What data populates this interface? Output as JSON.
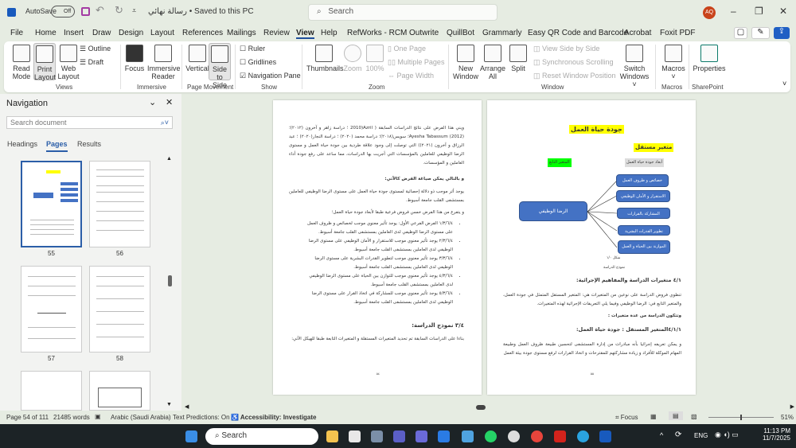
{
  "titlebar": {
    "autosave_label": "AutoSave",
    "autosave_state": "Off",
    "doc_title": "رسالة نهائي • Saved to this PC",
    "search_placeholder": "Search",
    "avatar_initials": "AQ"
  },
  "menu": [
    "File",
    "Home",
    "Insert",
    "Draw",
    "Design",
    "Layout",
    "References",
    "Mailings",
    "Review",
    "View",
    "Help",
    "RefWorks - RCM",
    "Outwrite",
    "QuillBot",
    "Grammarly",
    "Easy QR Code and Barcode",
    "Acrobat",
    "Foxit PDF"
  ],
  "ribbon": {
    "views": {
      "read": "Read Mode",
      "print": "Print Layout",
      "web": "Web Layout",
      "outline": "Outline",
      "draft": "Draft",
      "label": "Views"
    },
    "immersive": {
      "focus": "Focus",
      "reader": "Immersive Reader",
      "label": "Immersive"
    },
    "movement": {
      "vertical": "Vertical",
      "side": "Side to Side",
      "label": "Page Movement"
    },
    "show": {
      "ruler": "Ruler",
      "gridlines": "Gridlines",
      "navpane": "Navigation Pane",
      "label": "Show"
    },
    "zoom": {
      "thumbnails": "Thumbnails",
      "zoom": "Zoom",
      "pct": "100%",
      "one": "One Page",
      "multi": "Multiple Pages",
      "width": "Page Width",
      "label": "Zoom"
    },
    "window": {
      "new": "New Window",
      "arrange": "Arrange All",
      "split": "Split",
      "sbs": "View Side by Side",
      "sync": "Synchronous Scrolling",
      "reset": "Reset Window Position",
      "switch": "Switch Windows",
      "label": "Window"
    },
    "macros": {
      "btn": "Macros",
      "label": "Macros"
    },
    "sharepoint": {
      "btn": "Properties",
      "label": "SharePoint"
    }
  },
  "nav": {
    "title": "Navigation",
    "search_placeholder": "Search document",
    "tabs": [
      "Headings",
      "Pages",
      "Results"
    ],
    "pages": [
      "55",
      "56",
      "57",
      "58"
    ]
  },
  "left_page": {
    "p1": "ويني هذا الفرض على نتائج الدراسات السابقة ( Azril(2010 ؛ دراسة زاهر و آخرون (٢٠١٢)؛ Ayesha Tabassum (2012)؛ سويس(٢٠١٨)؛ دراسة محمد (٢٠٢٠) ؛ دراسة النجار(٢٠٢٠) ؛ عبد الرزاق و آخرون (٢٠٢١)) التي توصلت إلى وجود علاقة طردية بين جودة حياة العمل و مستوى الرضا الوظيفي للعاملين بالمؤسسات التي أجريت بها الدراسات، مما ساعد على رفع جودة أداء العاملين و المؤسسات.",
    "h1": "و بالتالي يمكن صياغة الفرض كالآتي:",
    "p2": "يوجد أثر موجب ذو دلالة إحصائية لمستوى جودة حياة العمل على مستوى الرضا الوظيفي للعاملين بمستشفى القلب جامعة أسيوط.",
    "p3": "و يتفرع من هذا الفرض خمس فروض فرعية طبقا لأبعاد جودة حياة العمل؛",
    "bullets": [
      "١/٣/٦/٤ الفرض الفرعي الأول: يوجد تأثير معنوي موجب لخصائص و ظروف العمل على مستوى الرضا الوظيفي لدى العاملين بمستشفى القلب جامعة أسيوط.",
      "٢/٣/٦/٤ يوجد تأثير معنوي موجب للاستقرار و الأمان الوظيفي على مستوى الرضا الوظيفي لدى العاملين بمستشفى القلب جامعة أسيوط.",
      "٣/٣/٦/٤ يوجد تأثير معنوي موجب لتطوير القدرات البشرية على مستوى الرضا الوظيفي لدى العاملين بمستشفى القلب جامعة أسيوط.",
      "٤/٣/٦/٤ يوجد تأثير معنوي موجب للتوازن بين الحياة على مستوى الرضا الوظيفي لدى العاملين بمستشفى القلب جامعة أسيوط.",
      "٥/٣/٦/٤ يوجد تأثير معنوي موجب للمشاركة في اتخاذ القرار على مستوى الرضا الوظيفي لدى العاملين بمستشفى القلب جامعة أسيوط."
    ],
    "h2": "٣/٤ نموذج الدراسة:",
    "p4": "بناءا على الدراسات السابقة تم تحديد المتغيرات المستقلة و المتغيرات التابعة طبقا للهيكل الآتي:",
    "num": "٥٤"
  },
  "right_page": {
    "title": "جودة حياة العمل",
    "indep": "متغير مستقل",
    "dep": "المتغير التابع",
    "dims": "أبعاد جودة حياة العمل",
    "boxes": [
      "خصائص و ظروف العمل",
      "الاستقرار و الأمان الوظيفي",
      "المشاركة بالقرارات",
      "تطوير القدرات البشرية",
      "الموازنة بين الحياة و العمل"
    ],
    "main_box": "الرضا الوظيفي",
    "fig": "شكل ١/٠",
    "fig_title": "نموذج الدراسة",
    "h1": "٤/١ متغيرات الدراسة والمفاهيم الإجرائية:",
    "p1": "تنطوي فروض الدراسة على نوعين من المتغيرات هي: المتغير المستقل المتمثل في جودة العمل، والمتغير التابع في: الرضا الوظيفي وفيما يلي التعريفات الإجرائية لهذه المتغيرات.",
    "h2": "وتتكون الدراسة من عدة متغيرات :",
    "h3": "٤/١/١المتغير المستقل : جودة حياة العمل:",
    "p2": "و يمكن تعريفه إجرائيا بأنه مبادرات من إدارة المستشفى لتحسين طبيعة ظروف العمل وطبيعة المهام الموكلة للأفراد و زيادة مشاركتهم للمقترحات و اتخاذ القرارات لرفع مستوى جودة بيئة العمل",
    "num": "٥٥"
  },
  "status": {
    "page": "Page 54 of 111",
    "words": "21485 words",
    "lang": "Arabic (Saudi Arabia)",
    "predictions": "Text Predictions: On",
    "accessibility": "Accessibility: Investigate",
    "focus": "Focus",
    "zoom": "51%"
  },
  "taskbar": {
    "search": "Search",
    "lang": "ENG",
    "time": "11:13 PM",
    "date": "11/7/2025"
  },
  "colors": {
    "accent": "#2b5ea8",
    "box": "#4472c4",
    "highlight": "#ffff00",
    "green": "#00ff00"
  }
}
